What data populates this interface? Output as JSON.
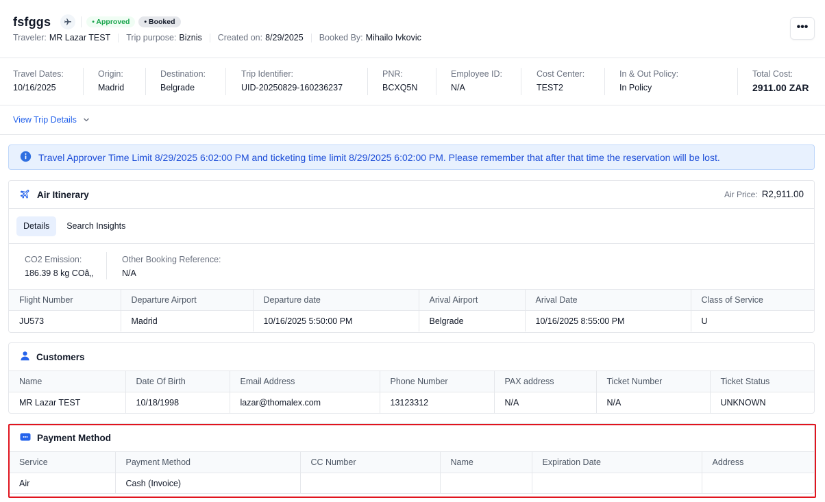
{
  "trip": {
    "title": "fsfggs",
    "badges": {
      "approved": "• Approved",
      "booked": "• Booked"
    },
    "meta": [
      {
        "label": "Traveler:",
        "value": "MR Lazar TEST"
      },
      {
        "label": "Trip purpose:",
        "value": "Biznis"
      },
      {
        "label": "Created on:",
        "value": "8/29/2025"
      },
      {
        "label": "Booked By:",
        "value": "Mihailo Ivkovic"
      }
    ],
    "more_label": "•••"
  },
  "info": [
    {
      "label": "Travel Dates:",
      "value": "10/16/2025"
    },
    {
      "label": "Origin:",
      "value": "Madrid"
    },
    {
      "label": "Destination:",
      "value": "Belgrade"
    },
    {
      "label": "Trip Identifier:",
      "value": "UID-20250829-160236237"
    },
    {
      "label": "PNR:",
      "value": "BCXQ5N"
    },
    {
      "label": "Employee ID:",
      "value": "N/A"
    },
    {
      "label": "Cost Center:",
      "value": "TEST2"
    },
    {
      "label": "In & Out Policy:",
      "value": "In Policy"
    },
    {
      "label": "Total Cost:",
      "value": "2911.00 ZAR"
    }
  ],
  "view_details": "View Trip Details",
  "alert": "Travel Approver Time Limit 8/29/2025 6:02:00 PM and ticketing time limit 8/29/2025 6:02:00 PM. Please remember that after that time the reservation will be lost.",
  "air": {
    "title": "Air Itinerary",
    "price_label": "Air Price:",
    "price_value": "R2,911.00",
    "tabs": [
      "Details",
      "Search Insights"
    ],
    "co2_label": "CO2 Emission:",
    "co2_value": "186.39 8 kg COâ‚‚",
    "other_ref_label": "Other Booking Reference:",
    "other_ref_value": "N/A",
    "columns": [
      "Flight Number",
      "Departure Airport",
      "Departure date",
      "Arival Airport",
      "Arival Date",
      "Class of Service"
    ],
    "rows": [
      [
        "JU573",
        "Madrid",
        "10/16/2025 5:50:00 PM",
        "Belgrade",
        "10/16/2025 8:55:00 PM",
        "U"
      ]
    ]
  },
  "customers": {
    "title": "Customers",
    "columns": [
      "Name",
      "Date Of Birth",
      "Email Address",
      "Phone Number",
      "PAX address",
      "Ticket Number",
      "Ticket Status"
    ],
    "rows": [
      [
        "MR Lazar TEST",
        "10/18/1998",
        "lazar@thomalex.com",
        "13123312",
        "N/A",
        "N/A",
        "UNKNOWN"
      ]
    ]
  },
  "payment": {
    "title": "Payment Method",
    "columns": [
      "Service",
      "Payment Method",
      "CC Number",
      "Name",
      "Expiration Date",
      "Address"
    ],
    "rows": [
      [
        "Air",
        "Cash (Invoice)",
        "",
        "",
        "",
        ""
      ]
    ]
  },
  "colors": {
    "accent": "#2563eb",
    "approved": "#16a34a",
    "alert_bg": "#e8f1fe",
    "highlight": "#e0141e"
  }
}
